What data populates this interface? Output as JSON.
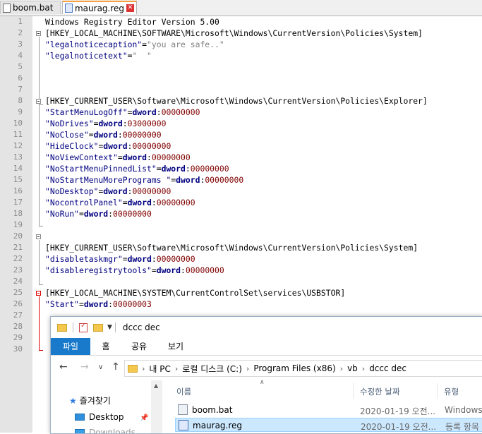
{
  "tabs": [
    {
      "label": "boom.bat",
      "active": false
    },
    {
      "label": "maurag.reg",
      "active": true
    }
  ],
  "editor": {
    "lines": [
      {
        "n": "1",
        "text": "Windows Registry Editor Version 5.00"
      },
      {
        "n": "2",
        "text": "[HKEY_LOCAL_MACHINE\\SOFTWARE\\Microsoft\\Windows\\CurrentVersion\\Policies\\System]"
      },
      {
        "n": "3",
        "k": "\"legalnoticecaption\"",
        "v": "\"you are safe..\""
      },
      {
        "n": "4",
        "k": "\"legalnoticetext\"",
        "v": "\"  \""
      },
      {
        "n": "5",
        "text": ""
      },
      {
        "n": "6",
        "text": ""
      },
      {
        "n": "7",
        "text": ""
      },
      {
        "n": "8",
        "text": "[HKEY_CURRENT_USER\\Software\\Microsoft\\Windows\\CurrentVersion\\Policies\\Explorer]"
      },
      {
        "n": "9",
        "k": "\"StartMenuLogOff\"",
        "d": "00000000"
      },
      {
        "n": "10",
        "k": "\"NoDrives\"",
        "d": "03000000"
      },
      {
        "n": "11",
        "k": "\"NoClose\"",
        "d": "00000000"
      },
      {
        "n": "12",
        "k": "\"HideClock\"",
        "d": "00000000"
      },
      {
        "n": "13",
        "k": "\"NoViewContext\"",
        "d": "00000000"
      },
      {
        "n": "14",
        "k": "\"NoStartMenuPinnedList\"",
        "d": "00000000"
      },
      {
        "n": "15",
        "k": "\"NoStartMenuMorePrograms \"",
        "d": "00000000"
      },
      {
        "n": "16",
        "k": "\"NoDesktop\"",
        "d": "00000000"
      },
      {
        "n": "17",
        "k": "\"NocontrolPanel\"",
        "d": "00000000"
      },
      {
        "n": "18",
        "k": "\"NoRun\"",
        "d": "00000000"
      },
      {
        "n": "19",
        "text": ""
      },
      {
        "n": "20",
        "text": ""
      },
      {
        "n": "21",
        "text": "[HKEY_CURRENT_USER\\Software\\Microsoft\\Windows\\CurrentVersion\\Policies\\System]"
      },
      {
        "n": "22",
        "k": "\"disabletaskmgr\"",
        "d": "00000000"
      },
      {
        "n": "23",
        "k": "\"disableregistrytools\"",
        "d": "00000000"
      },
      {
        "n": "24",
        "text": ""
      },
      {
        "n": "25",
        "text": "[HKEY_LOCAL_MACHINE\\SYSTEM\\CurrentControlSet\\services\\USBSTOR]"
      },
      {
        "n": "26",
        "k": "\"Start\"",
        "d": "00000003"
      },
      {
        "n": "27",
        "text": ""
      },
      {
        "n": "28",
        "text": ""
      },
      {
        "n": "29",
        "text": ""
      },
      {
        "n": "30",
        "text": ""
      }
    ],
    "dword_label": "dword",
    "colors": {
      "key": "#000080",
      "string": "#808080",
      "number": "#800000",
      "fold_active": "#dd0000"
    }
  },
  "explorer": {
    "title": "dccc dec",
    "ribbon_tabs": [
      "파일",
      "홈",
      "공유",
      "보기"
    ],
    "address": [
      "내 PC",
      "로컬 디스크 (C:)",
      "Program Files (x86)",
      "vb",
      "dccc dec"
    ],
    "nav": {
      "favorites": "즐겨찾기",
      "desktop": "Desktop",
      "downloads": "Downloads"
    },
    "columns": {
      "name": "이름",
      "date": "수정한 날짜",
      "type": "유형"
    },
    "files": [
      {
        "name": "boom.bat",
        "date": "2020-01-19 오전...",
        "type": "Windows"
      },
      {
        "name": "maurag.reg",
        "date": "2020-01-19 오전...",
        "type": "등록 항목"
      }
    ]
  }
}
